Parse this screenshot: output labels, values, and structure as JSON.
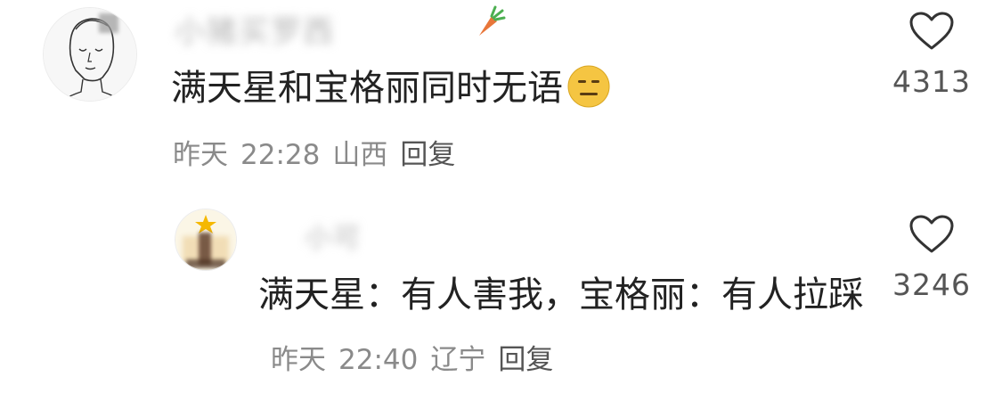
{
  "comments": [
    {
      "username": "小猪买罗西",
      "text": "满天星和宝格丽同时无语",
      "emoji": "expressionless-face",
      "date": "昨天",
      "time": "22:28",
      "location": "山西",
      "reply_label": "回复",
      "like_count": "4313"
    },
    {
      "username": "小可",
      "text": "满天星：有人害我，宝格丽：有人拉踩",
      "date": "昨天",
      "time": "22:40",
      "location": "辽宁",
      "reply_label": "回复",
      "like_count": "3246"
    }
  ],
  "icons": {
    "like": "heart-outline-icon",
    "badge": "carrot-icon"
  },
  "colors": {
    "text": "#222222",
    "meta": "#8a8a8a",
    "count": "#555555",
    "blurred_name": "#b5b5b5"
  }
}
